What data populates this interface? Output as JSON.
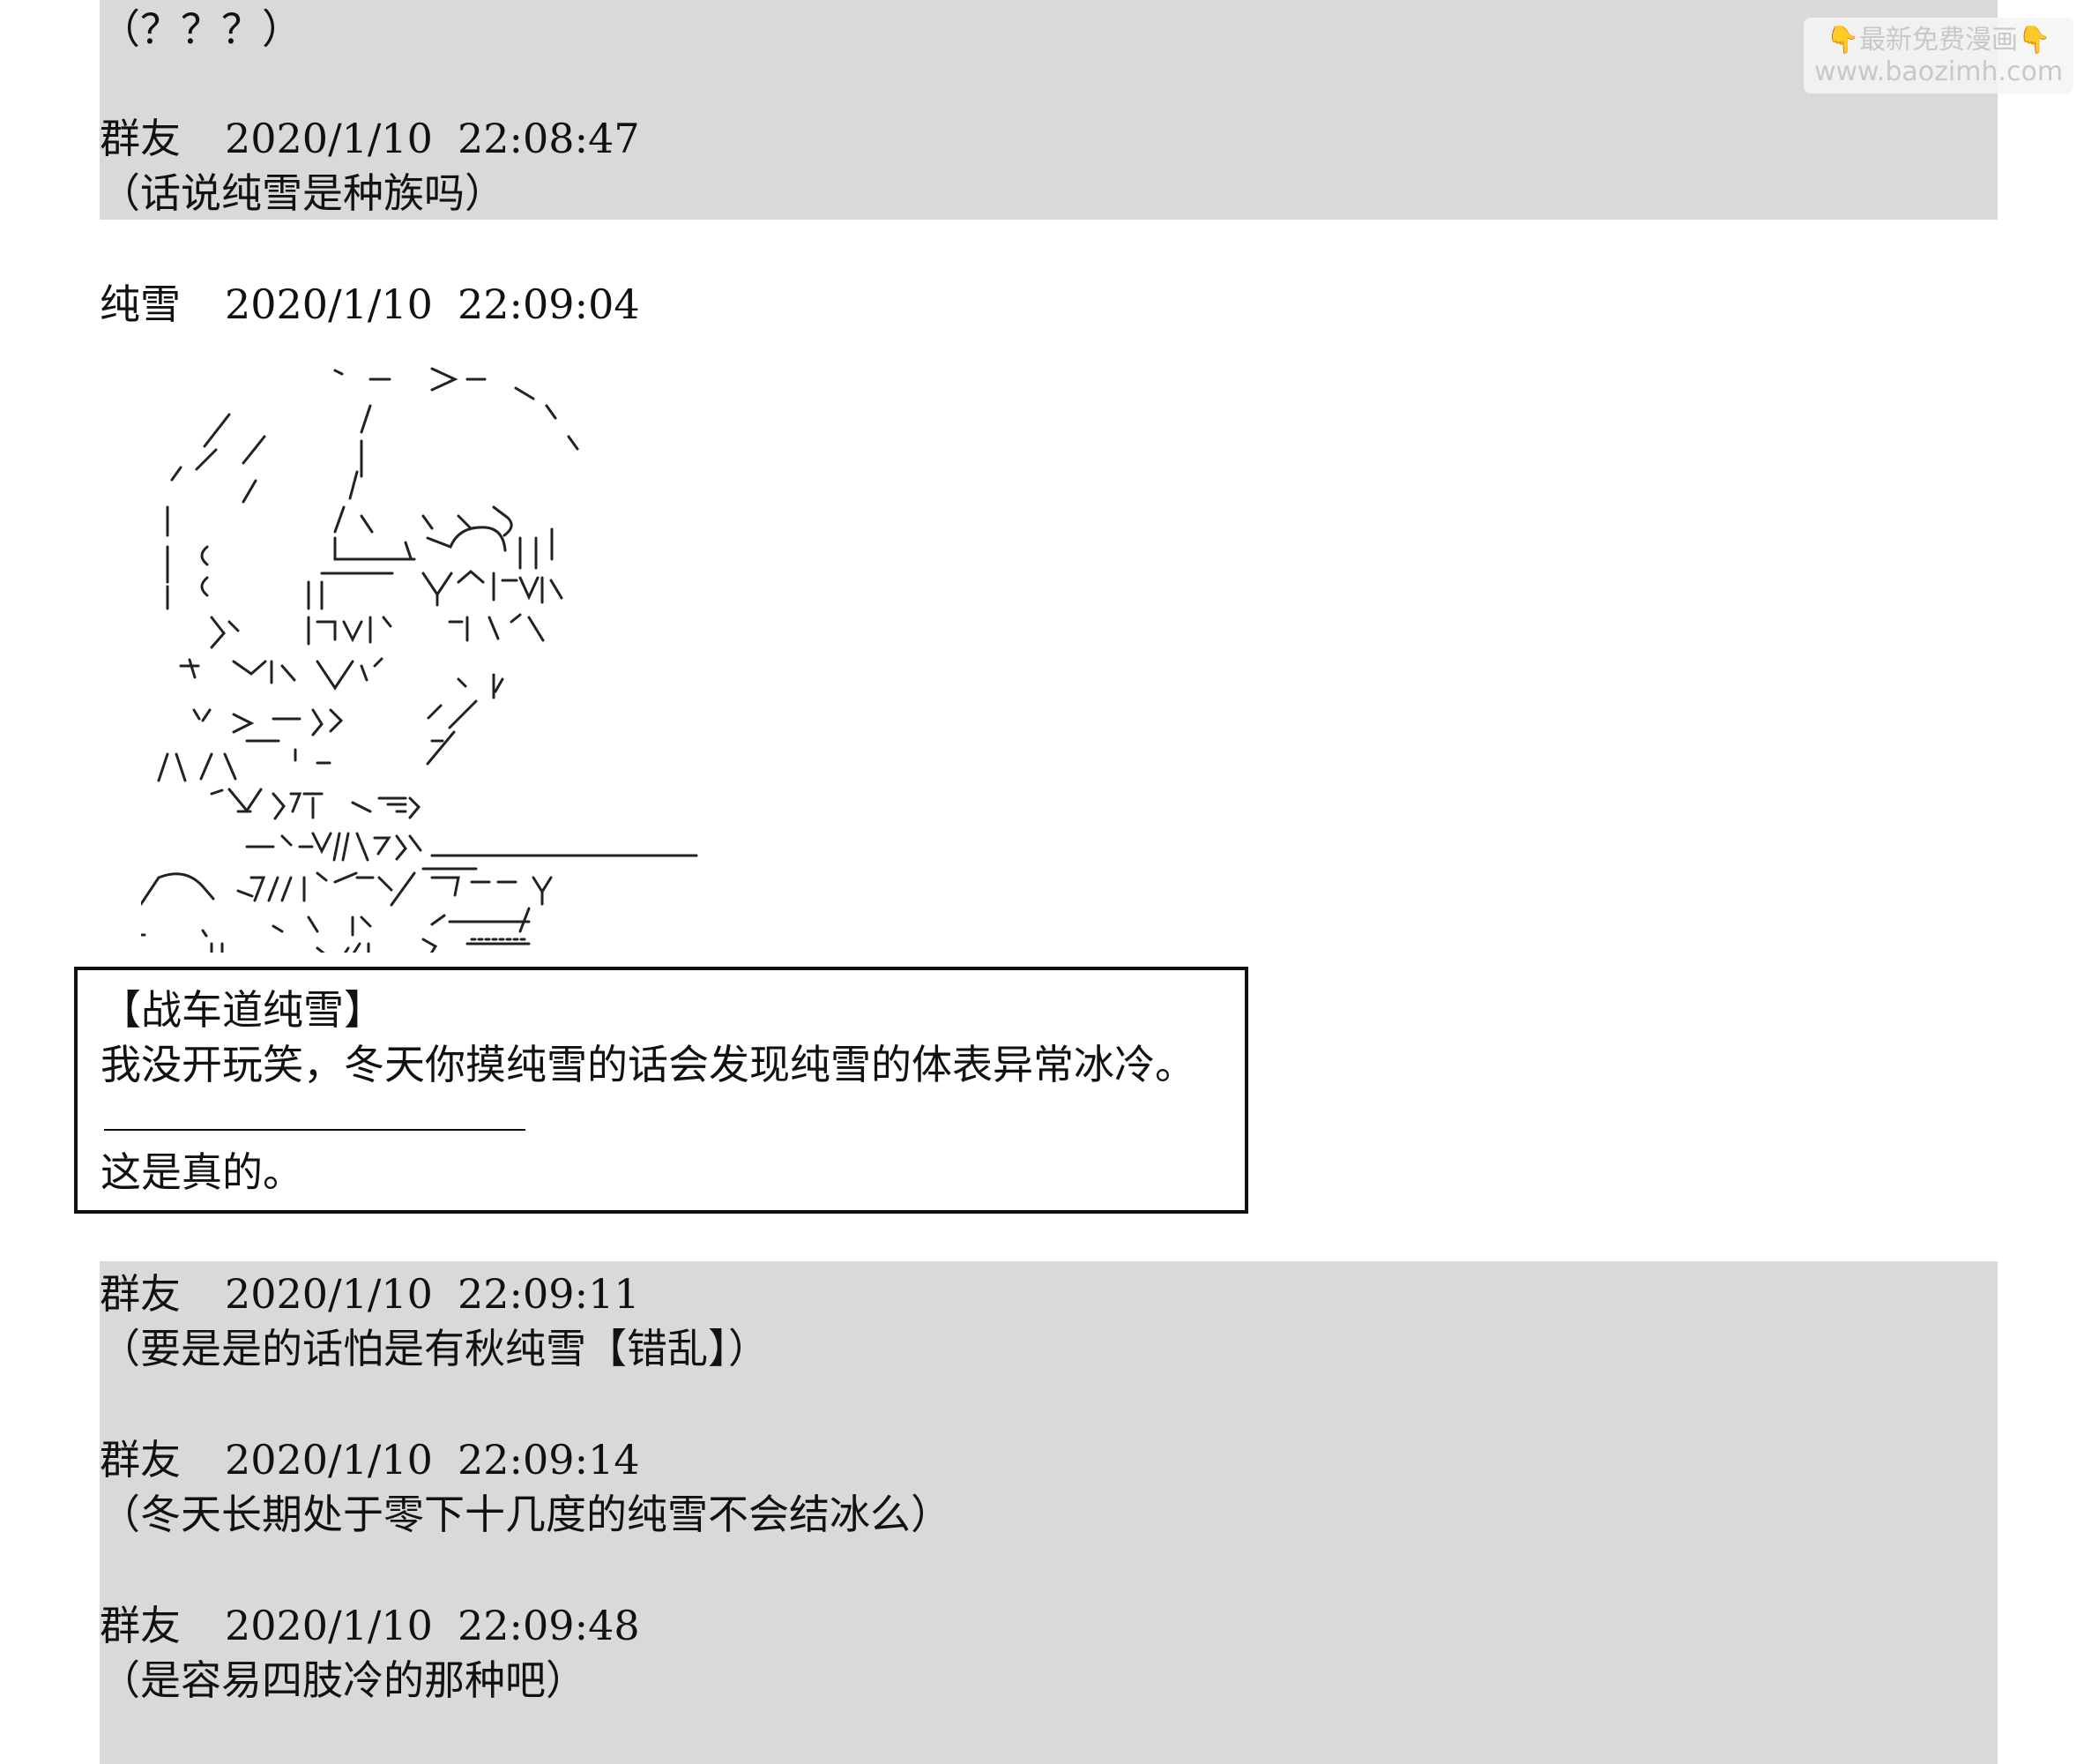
{
  "watermark": {
    "line1": "👇最新免费漫画👇",
    "line2": "www.baozimh.com"
  },
  "messages": [
    {
      "text": "（？？？）"
    },
    {
      "name": "群友",
      "date": "2020/1/10",
      "time": "22:08:47",
      "text": "（话说纯雪是种族吗）"
    },
    {
      "name": "纯雪",
      "date": "2020/1/10",
      "time": "22:09:04"
    },
    {
      "name": "群友",
      "date": "2020/1/10",
      "time": "22:09:11",
      "text": "（要是是的话怕是有秋纯雪【错乱】）"
    },
    {
      "name": "群友",
      "date": "2020/1/10",
      "time": "22:09:14",
      "text": "（冬天长期处于零下十几度的纯雪不会结冰么）"
    },
    {
      "name": "群友",
      "date": "2020/1/10",
      "time": "22:09:48",
      "text": "（是容易四肢冷的那种吧）"
    }
  ],
  "quote": {
    "title": "【战车道纯雪】",
    "body": "我没开玩笑，冬天你摸纯雪的话会发现纯雪的体表异常冰冷。",
    "footer": "这是真的。"
  },
  "ascii_art": {
    "lines": [
      "ﾞ -  >-  .",
      "/     /      ヽ",
      "/ /     |       ヽ",
      "/  /     ﾊ       ヽ",
      "|       / ' ,   ' 丶   }",
      "| {     |___ '|  く、ｨ⌒|  }|",
      "{ {   {|￣￣ 乂へ 斬V  ﾙ",
      "入'   {ﾑ卅'  ﾞﾋﾘﾉﾉ",
      "マ {＼ Y Vﾘ    丶  ﾘ",
      "ﾊ ゝ ー ‐ ≦ゝ        /",
      "八 ハ￣  i 、    ﾞ ／",
      "ゝ乂ソア、_  ≧ｨｱ",
      "ー^ー.  ///ﾄﾘﾏ、",
      "/⌒ヽ   ﾏ// {ｨﾞーミ /￣ヴ ー ー Y",
      "'   '   ﾞ   ﾟ  lｧ   ｲ ‐-‐‐‐/",
      "|    ||     ＼//L    ソ"
    ]
  }
}
